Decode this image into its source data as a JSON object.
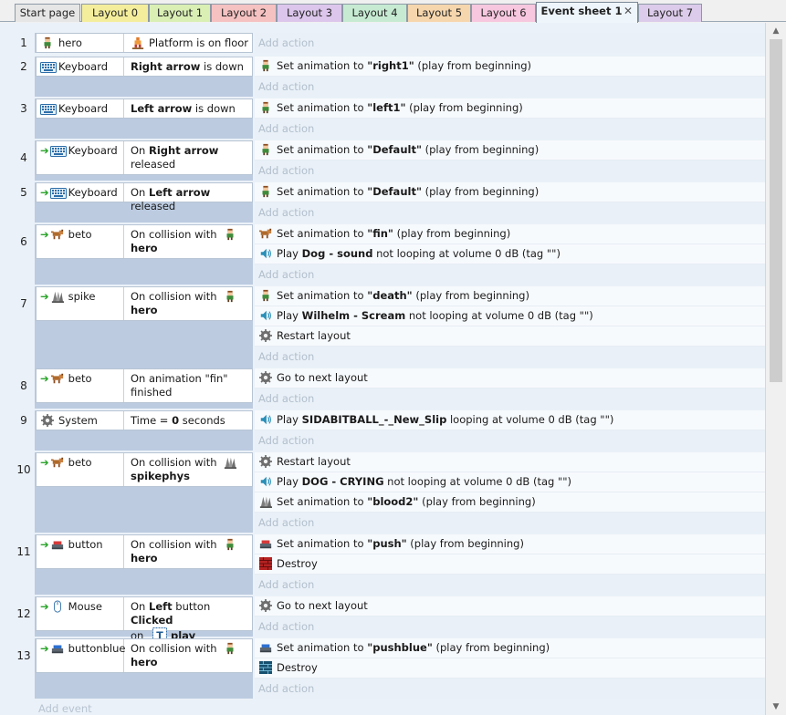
{
  "tabs": [
    {
      "label": "Start page",
      "color": "#e6e6e6"
    },
    {
      "label": "Layout 0",
      "color": "#f4ee9c"
    },
    {
      "label": "Layout 1",
      "color": "#d9efb4"
    },
    {
      "label": "Layout 2",
      "color": "#f5c1c1"
    },
    {
      "label": "Layout 3",
      "color": "#dcc6ec"
    },
    {
      "label": "Layout 4",
      "color": "#c6ebd2"
    },
    {
      "label": "Layout 5",
      "color": "#f6d6ad"
    },
    {
      "label": "Layout 6",
      "color": "#f6c7de"
    },
    {
      "label": "Event sheet 1",
      "color": "#eef5fb",
      "close": "✕"
    },
    {
      "label": "Layout 7",
      "color": "#dccbea"
    }
  ],
  "add_action_label": "Add action",
  "add_event_label": "Add event",
  "events": [
    {
      "num": "1",
      "arrow": false,
      "object": "hero",
      "object_icon": "hero-icon",
      "cond": [
        {
          "icon": "platform-icon",
          "parts": [
            {
              "t": "Platform is on floor"
            }
          ]
        }
      ],
      "actions": []
    },
    {
      "num": "2",
      "arrow": false,
      "object": "Keyboard",
      "object_icon": "keyboard-icon",
      "cond": [
        {
          "parts": [
            {
              "t": "Right arrow",
              "b": true
            },
            {
              "t": " is down"
            }
          ]
        }
      ],
      "actions": [
        {
          "icon": "hero-icon",
          "parts": [
            {
              "t": "Set animation to "
            },
            {
              "t": "\"right1\"",
              "b": true
            },
            {
              "t": " (play from beginning)"
            }
          ]
        }
      ]
    },
    {
      "num": "3",
      "arrow": false,
      "object": "Keyboard",
      "object_icon": "keyboard-icon",
      "cond": [
        {
          "parts": [
            {
              "t": "Left arrow",
              "b": true
            },
            {
              "t": " is down"
            }
          ]
        }
      ],
      "actions": [
        {
          "icon": "hero-icon",
          "parts": [
            {
              "t": "Set animation to "
            },
            {
              "t": "\"left1\"",
              "b": true
            },
            {
              "t": " (play from beginning)"
            }
          ]
        }
      ]
    },
    {
      "num": "4",
      "arrow": true,
      "object": "Keyboard",
      "object_icon": "keyboard-icon",
      "cond": [
        {
          "parts": [
            {
              "t": "On "
            },
            {
              "t": "Right arrow",
              "b": true
            }
          ]
        },
        {
          "parts": [
            {
              "t": "released"
            }
          ]
        }
      ],
      "actions": [
        {
          "icon": "hero-icon",
          "parts": [
            {
              "t": "Set animation to "
            },
            {
              "t": "\"Default\"",
              "b": true
            },
            {
              "t": " (play from beginning)"
            }
          ]
        }
      ]
    },
    {
      "num": "5",
      "arrow": true,
      "object": "Keyboard",
      "object_icon": "keyboard-icon",
      "cond": [
        {
          "parts": [
            {
              "t": "On "
            },
            {
              "t": "Left arrow",
              "b": true
            },
            {
              "t": " released"
            }
          ]
        }
      ],
      "actions": [
        {
          "icon": "hero-icon",
          "parts": [
            {
              "t": "Set animation to "
            },
            {
              "t": "\"Default\"",
              "b": true
            },
            {
              "t": " (play from beginning)"
            }
          ]
        }
      ]
    },
    {
      "num": "6",
      "arrow": true,
      "object": "beto",
      "object_icon": "dog-icon",
      "cond": [
        {
          "parts": [
            {
              "t": "On collision with"
            }
          ],
          "icon_after": "hero-icon"
        },
        {
          "parts": [
            {
              "t": "hero",
              "b": true
            }
          ]
        }
      ],
      "actions": [
        {
          "icon": "dog-icon",
          "parts": [
            {
              "t": "Set animation to "
            },
            {
              "t": "\"fin\"",
              "b": true
            },
            {
              "t": " (play from beginning)"
            }
          ]
        },
        {
          "icon": "speaker-icon",
          "parts": [
            {
              "t": "Play "
            },
            {
              "t": "Dog - sound",
              "b": true
            },
            {
              "t": " not looping at volume 0 dB (tag \"\")"
            }
          ]
        }
      ]
    },
    {
      "num": "7",
      "arrow": true,
      "object": "spike",
      "object_icon": "spike-icon",
      "cond": [
        {
          "parts": [
            {
              "t": "On collision with"
            }
          ],
          "icon_after": "hero-icon"
        },
        {
          "parts": [
            {
              "t": "hero",
              "b": true
            }
          ]
        }
      ],
      "actions": [
        {
          "icon": "hero-icon",
          "parts": [
            {
              "t": "Set animation to "
            },
            {
              "t": "\"death\"",
              "b": true
            },
            {
              "t": " (play from beginning)"
            }
          ]
        },
        {
          "icon": "speaker-icon",
          "parts": [
            {
              "t": "Play "
            },
            {
              "t": "Wilhelm - Scream",
              "b": true
            },
            {
              "t": " not looping at volume 0 dB (tag \"\")"
            }
          ]
        },
        {
          "icon": "gear-icon",
          "parts": [
            {
              "t": "Restart layout"
            }
          ]
        }
      ]
    },
    {
      "num": "8",
      "arrow": true,
      "object": "beto",
      "object_icon": "dog-icon",
      "cond": [
        {
          "parts": [
            {
              "t": "On animation \"fin\""
            }
          ]
        },
        {
          "parts": [
            {
              "t": "finished"
            }
          ]
        }
      ],
      "actions": [
        {
          "icon": "gear-icon",
          "parts": [
            {
              "t": "Go to next layout"
            }
          ]
        }
      ]
    },
    {
      "num": "9",
      "arrow": false,
      "object": "System",
      "object_icon": "gear-icon",
      "cond": [
        {
          "parts": [
            {
              "t": "Time = "
            },
            {
              "t": "0",
              "b": true
            },
            {
              "t": " seconds"
            }
          ]
        }
      ],
      "actions": [
        {
          "icon": "speaker-icon",
          "parts": [
            {
              "t": "Play "
            },
            {
              "t": "SIDABITBALL_-_New_Slip",
              "b": true
            },
            {
              "t": " looping at volume 0 dB (tag \"\")"
            }
          ]
        }
      ]
    },
    {
      "num": "10",
      "arrow": true,
      "object": "beto",
      "object_icon": "dog-icon",
      "cond": [
        {
          "parts": [
            {
              "t": "On collision with"
            }
          ],
          "icon_after": "spike-icon"
        },
        {
          "parts": [
            {
              "t": "spikephys",
              "b": true
            }
          ]
        }
      ],
      "actions": [
        {
          "icon": "gear-icon",
          "parts": [
            {
              "t": "Restart layout"
            }
          ]
        },
        {
          "icon": "speaker-icon",
          "parts": [
            {
              "t": "Play "
            },
            {
              "t": "DOG - CRYING",
              "b": true
            },
            {
              "t": " not looping at volume 0 dB (tag \"\")"
            }
          ]
        },
        {
          "icon": "spike-icon",
          "parts": [
            {
              "t": "Set animation to "
            },
            {
              "t": "\"blood2\"",
              "b": true
            },
            {
              "t": " (play from beginning)"
            }
          ]
        }
      ]
    },
    {
      "num": "11",
      "arrow": true,
      "object": "button",
      "object_icon": "red-button-icon",
      "cond": [
        {
          "parts": [
            {
              "t": "On collision with"
            }
          ],
          "icon_after": "hero-icon"
        },
        {
          "parts": [
            {
              "t": "hero",
              "b": true
            }
          ]
        }
      ],
      "actions": [
        {
          "icon": "red-button-icon",
          "parts": [
            {
              "t": "Set animation to "
            },
            {
              "t": "\"push\"",
              "b": true
            },
            {
              "t": " (play from beginning)"
            }
          ]
        },
        {
          "icon": "red-brick-icon",
          "parts": [
            {
              "t": "Destroy"
            }
          ]
        }
      ]
    },
    {
      "num": "12",
      "arrow": true,
      "object": "Mouse",
      "object_icon": "mouse-icon",
      "cond": [
        {
          "parts": [
            {
              "t": "On "
            },
            {
              "t": "Left",
              "b": true
            },
            {
              "t": " button "
            },
            {
              "t": "Clicked",
              "b": true
            }
          ]
        },
        {
          "parts": [
            {
              "t": "on "
            }
          ],
          "icon_after": "text-object-icon",
          "parts_after": [
            {
              "t": "play",
              "b": true
            }
          ]
        }
      ],
      "actions": [
        {
          "icon": "gear-icon",
          "parts": [
            {
              "t": "Go to next layout"
            }
          ]
        }
      ]
    },
    {
      "num": "13",
      "arrow": true,
      "object": "buttonblue",
      "object_icon": "blue-button-icon",
      "cond": [
        {
          "parts": [
            {
              "t": "On collision with"
            }
          ],
          "icon_after": "hero-icon"
        },
        {
          "parts": [
            {
              "t": "hero",
              "b": true
            }
          ]
        }
      ],
      "actions": [
        {
          "icon": "blue-button-icon",
          "parts": [
            {
              "t": "Set animation to "
            },
            {
              "t": "\"pushblue\"",
              "b": true
            },
            {
              "t": " (play from beginning)"
            }
          ]
        },
        {
          "icon": "blue-brick-icon",
          "parts": [
            {
              "t": "Destroy"
            }
          ]
        }
      ]
    }
  ]
}
